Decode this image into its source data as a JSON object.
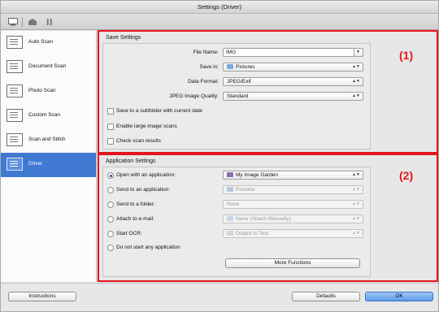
{
  "window": {
    "title": "Settings (Driver)"
  },
  "toolbar": {
    "icons": [
      "scan-from-computer-icon",
      "scan-from-panel-icon",
      "general-settings-icon"
    ]
  },
  "sidebar": {
    "items": [
      {
        "label": "Auto Scan",
        "icon": "auto-scan-icon",
        "active": false
      },
      {
        "label": "Document Scan",
        "icon": "document-scan-icon",
        "active": false
      },
      {
        "label": "Photo Scan",
        "icon": "photo-scan-icon",
        "active": false
      },
      {
        "label": "Custom Scan",
        "icon": "custom-scan-icon",
        "active": false
      },
      {
        "label": "Scan and Stitch",
        "icon": "scan-and-stitch-icon",
        "active": false
      },
      {
        "label": "Driver",
        "icon": "driver-icon",
        "active": true
      }
    ]
  },
  "save_settings": {
    "title": "Save Settings",
    "callout": "(1)",
    "file_name": {
      "label": "File Name:",
      "value": "IMG"
    },
    "save_in": {
      "label": "Save in:",
      "value": "Pictures"
    },
    "data_format": {
      "label": "Data Format:",
      "value": "JPEG/Exif"
    },
    "jpeg_quality": {
      "label": "JPEG Image Quality:",
      "value": "Standard"
    },
    "checks": [
      {
        "label": "Save to a subfolder with current date",
        "checked": false
      },
      {
        "label": "Enable large image scans",
        "checked": false
      },
      {
        "label": "Check scan results",
        "checked": false
      }
    ]
  },
  "app_settings": {
    "title": "Application Settings",
    "callout": "(2)",
    "options": [
      {
        "label": "Open with an application:",
        "selected": true,
        "value": "My Image Garden",
        "enabled": true
      },
      {
        "label": "Send to an application:",
        "selected": false,
        "value": "Preview",
        "enabled": false
      },
      {
        "label": "Send to a folder:",
        "selected": false,
        "value": "None",
        "enabled": false
      },
      {
        "label": "Attach to e-mail:",
        "selected": false,
        "value": "None (Attach Manually)",
        "enabled": false
      },
      {
        "label": "Start OCR:",
        "selected": false,
        "value": "Output to Text",
        "enabled": false
      },
      {
        "label": "Do not start any application",
        "selected": false
      }
    ],
    "more_functions": "More Functions"
  },
  "footer": {
    "instructions": "Instructions",
    "defaults": "Defaults",
    "ok": "OK"
  },
  "colors": {
    "accent": "#3f79d2",
    "callout_red": "#e3141a"
  }
}
